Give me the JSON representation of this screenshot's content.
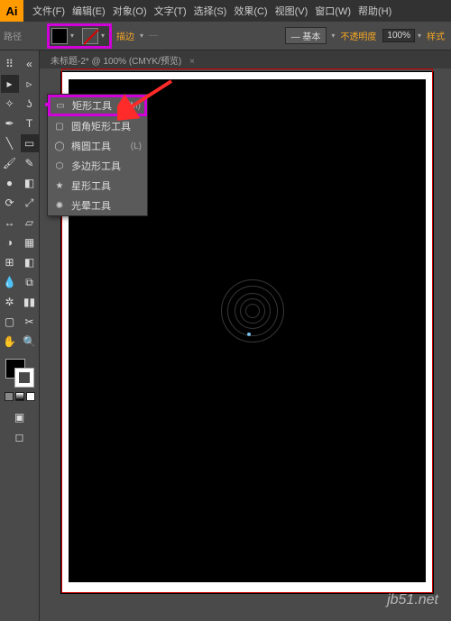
{
  "app": {
    "logo": "Ai"
  },
  "menu": {
    "file": "文件(F)",
    "edit": "编辑(E)",
    "object": "对象(O)",
    "type": "文字(T)",
    "select": "选择(S)",
    "effect": "效果(C)",
    "view": "视图(V)",
    "window": "窗口(W)",
    "help": "帮助(H)"
  },
  "options": {
    "label": "路径",
    "stroke_label": "描边",
    "stroke_dash": "—",
    "style_label": "— 基本",
    "opacity_label": "不透明度",
    "zoom": "100%",
    "style_btn": "样式"
  },
  "doc": {
    "title": "未标题-2* @ 100% (CMYK/预览)",
    "close": "×"
  },
  "flyout": {
    "rect": {
      "label": "矩形工具",
      "key": "(M)"
    },
    "rounded": {
      "label": "圆角矩形工具"
    },
    "ellipse": {
      "label": "椭圆工具",
      "key": "(L)"
    },
    "polygon": {
      "label": "多边形工具"
    },
    "star": {
      "label": "星形工具"
    },
    "flare": {
      "label": "光晕工具"
    }
  },
  "watermark": {
    "site": "jb51.net"
  }
}
